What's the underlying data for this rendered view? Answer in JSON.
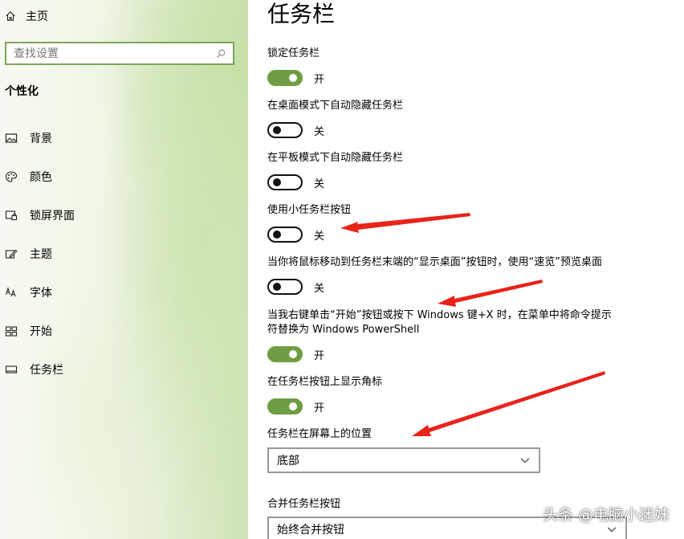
{
  "sidebar": {
    "home_label": "主页",
    "search_placeholder": "查找设置",
    "section_title": "个性化",
    "items": [
      {
        "label": "背景",
        "icon": "image-icon"
      },
      {
        "label": "颜色",
        "icon": "palette-icon"
      },
      {
        "label": "锁屏界面",
        "icon": "lock-screen-icon"
      },
      {
        "label": "主题",
        "icon": "theme-icon"
      },
      {
        "label": "字体",
        "icon": "font-icon"
      },
      {
        "label": "开始",
        "icon": "start-icon"
      },
      {
        "label": "任务栏",
        "icon": "taskbar-icon"
      }
    ]
  },
  "main": {
    "title": "任务栏",
    "settings": [
      {
        "label": "锁定任务栏",
        "state": "开",
        "on": true
      },
      {
        "label": "在桌面模式下自动隐藏任务栏",
        "state": "关",
        "on": false
      },
      {
        "label": "在平板模式下自动隐藏任务栏",
        "state": "关",
        "on": false
      },
      {
        "label": "使用小任务栏按钮",
        "state": "关",
        "on": false
      },
      {
        "label": "当你将鼠标移动到任务栏末端的“显示桌面”按钮时，使用“速览”预览桌面",
        "state": "关",
        "on": false
      },
      {
        "label": "当我右键单击“开始”按钮或按下 Windows 键+X 时，在菜单中将命令提示符替换为 Windows PowerShell",
        "state": "开",
        "on": true
      },
      {
        "label": "在任务栏按钮上显示角标",
        "state": "开",
        "on": true
      }
    ],
    "position": {
      "label": "任务栏在屏幕上的位置",
      "value": "底部"
    },
    "combine": {
      "label": "合并任务栏按钮",
      "value": "始终合并按钮"
    }
  },
  "watermark": "头条 @电脑小迷妹",
  "colors": {
    "accent": "#6f9d44",
    "search_border": "#7ea55a",
    "annotation_arrow": "#e8231a"
  }
}
